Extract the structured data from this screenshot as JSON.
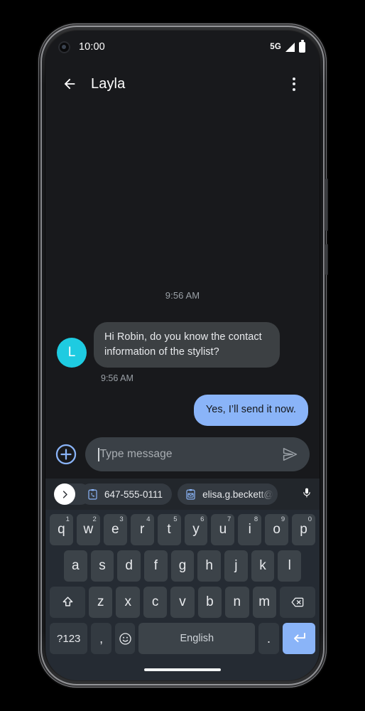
{
  "status_bar": {
    "time": "10:00",
    "network": "5G",
    "icons": [
      "camera-hole",
      "signal-icon",
      "battery-icon"
    ]
  },
  "app_bar": {
    "back_icon": "back-arrow-icon",
    "title": "Layla",
    "overflow_icon": "more-vert-icon"
  },
  "conversation": {
    "day_stamp": "9:56 AM",
    "messages": [
      {
        "direction": "incoming",
        "avatar_initial": "L",
        "avatar_color": "#1ecbe1",
        "text": "Hi Robin, do you know the contact information of the stylist?",
        "timestamp": "9:56 AM"
      },
      {
        "direction": "outgoing",
        "text": "Yes, I’ll send it now.",
        "bubble_color": "#8ab4f8"
      }
    ]
  },
  "compose": {
    "attach_icon": "add-circle-icon",
    "placeholder": "Type message",
    "value": "",
    "send_icon": "send-icon"
  },
  "suggestions": {
    "expand_icon": "chevron-right-icon",
    "chips": [
      {
        "icon": "clipboard-phone-icon",
        "label": "647-555-0111"
      },
      {
        "icon": "clipboard-email-icon",
        "label": "elisa.g.beckett@"
      }
    ],
    "mic_icon": "microphone-icon"
  },
  "keyboard": {
    "row1": [
      {
        "key": "q",
        "sup": "1"
      },
      {
        "key": "w",
        "sup": "2"
      },
      {
        "key": "e",
        "sup": "3"
      },
      {
        "key": "r",
        "sup": "4"
      },
      {
        "key": "t",
        "sup": "5"
      },
      {
        "key": "y",
        "sup": "6"
      },
      {
        "key": "u",
        "sup": "7"
      },
      {
        "key": "i",
        "sup": "8"
      },
      {
        "key": "o",
        "sup": "9"
      },
      {
        "key": "p",
        "sup": "0"
      }
    ],
    "row2": [
      "a",
      "s",
      "d",
      "f",
      "g",
      "h",
      "j",
      "k",
      "l"
    ],
    "row3": {
      "shift": "shift-icon",
      "letters": [
        "z",
        "x",
        "c",
        "v",
        "b",
        "n",
        "m"
      ],
      "backspace": "backspace-icon"
    },
    "row4": {
      "symbols": "?123",
      "comma": ",",
      "emoji": "emoji-icon",
      "space": "English",
      "period": ".",
      "enter": "enter-icon"
    }
  },
  "colors": {
    "screen_bg": "#18191c",
    "bubble_in": "#3c4043",
    "bubble_out": "#8ab4f8",
    "accent_blue": "#8ab4f8",
    "avatar": "#1ecbe1",
    "keyboard_bg": "#252b33",
    "key_bg": "#3c4349"
  }
}
